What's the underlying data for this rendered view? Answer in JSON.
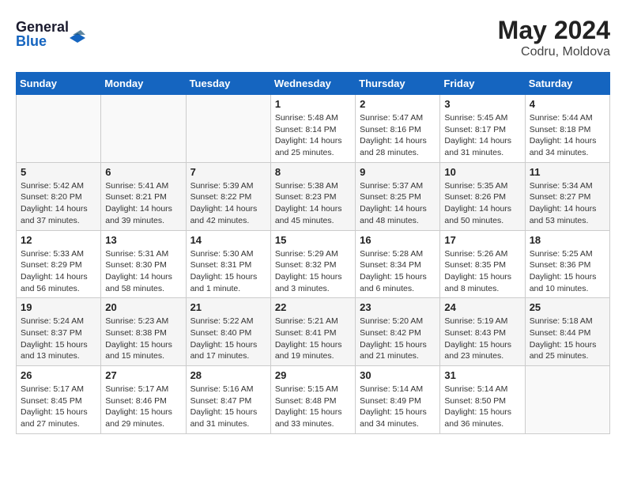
{
  "header": {
    "logo_line1": "General",
    "logo_line2": "Blue",
    "month_year": "May 2024",
    "location": "Codru, Moldova"
  },
  "weekdays": [
    "Sunday",
    "Monday",
    "Tuesday",
    "Wednesday",
    "Thursday",
    "Friday",
    "Saturday"
  ],
  "weeks": [
    [
      {
        "day": "",
        "info": ""
      },
      {
        "day": "",
        "info": ""
      },
      {
        "day": "",
        "info": ""
      },
      {
        "day": "1",
        "info": "Sunrise: 5:48 AM\nSunset: 8:14 PM\nDaylight: 14 hours\nand 25 minutes."
      },
      {
        "day": "2",
        "info": "Sunrise: 5:47 AM\nSunset: 8:16 PM\nDaylight: 14 hours\nand 28 minutes."
      },
      {
        "day": "3",
        "info": "Sunrise: 5:45 AM\nSunset: 8:17 PM\nDaylight: 14 hours\nand 31 minutes."
      },
      {
        "day": "4",
        "info": "Sunrise: 5:44 AM\nSunset: 8:18 PM\nDaylight: 14 hours\nand 34 minutes."
      }
    ],
    [
      {
        "day": "5",
        "info": "Sunrise: 5:42 AM\nSunset: 8:20 PM\nDaylight: 14 hours\nand 37 minutes."
      },
      {
        "day": "6",
        "info": "Sunrise: 5:41 AM\nSunset: 8:21 PM\nDaylight: 14 hours\nand 39 minutes."
      },
      {
        "day": "7",
        "info": "Sunrise: 5:39 AM\nSunset: 8:22 PM\nDaylight: 14 hours\nand 42 minutes."
      },
      {
        "day": "8",
        "info": "Sunrise: 5:38 AM\nSunset: 8:23 PM\nDaylight: 14 hours\nand 45 minutes."
      },
      {
        "day": "9",
        "info": "Sunrise: 5:37 AM\nSunset: 8:25 PM\nDaylight: 14 hours\nand 48 minutes."
      },
      {
        "day": "10",
        "info": "Sunrise: 5:35 AM\nSunset: 8:26 PM\nDaylight: 14 hours\nand 50 minutes."
      },
      {
        "day": "11",
        "info": "Sunrise: 5:34 AM\nSunset: 8:27 PM\nDaylight: 14 hours\nand 53 minutes."
      }
    ],
    [
      {
        "day": "12",
        "info": "Sunrise: 5:33 AM\nSunset: 8:29 PM\nDaylight: 14 hours\nand 56 minutes."
      },
      {
        "day": "13",
        "info": "Sunrise: 5:31 AM\nSunset: 8:30 PM\nDaylight: 14 hours\nand 58 minutes."
      },
      {
        "day": "14",
        "info": "Sunrise: 5:30 AM\nSunset: 8:31 PM\nDaylight: 15 hours\nand 1 minute."
      },
      {
        "day": "15",
        "info": "Sunrise: 5:29 AM\nSunset: 8:32 PM\nDaylight: 15 hours\nand 3 minutes."
      },
      {
        "day": "16",
        "info": "Sunrise: 5:28 AM\nSunset: 8:34 PM\nDaylight: 15 hours\nand 6 minutes."
      },
      {
        "day": "17",
        "info": "Sunrise: 5:26 AM\nSunset: 8:35 PM\nDaylight: 15 hours\nand 8 minutes."
      },
      {
        "day": "18",
        "info": "Sunrise: 5:25 AM\nSunset: 8:36 PM\nDaylight: 15 hours\nand 10 minutes."
      }
    ],
    [
      {
        "day": "19",
        "info": "Sunrise: 5:24 AM\nSunset: 8:37 PM\nDaylight: 15 hours\nand 13 minutes."
      },
      {
        "day": "20",
        "info": "Sunrise: 5:23 AM\nSunset: 8:38 PM\nDaylight: 15 hours\nand 15 minutes."
      },
      {
        "day": "21",
        "info": "Sunrise: 5:22 AM\nSunset: 8:40 PM\nDaylight: 15 hours\nand 17 minutes."
      },
      {
        "day": "22",
        "info": "Sunrise: 5:21 AM\nSunset: 8:41 PM\nDaylight: 15 hours\nand 19 minutes."
      },
      {
        "day": "23",
        "info": "Sunrise: 5:20 AM\nSunset: 8:42 PM\nDaylight: 15 hours\nand 21 minutes."
      },
      {
        "day": "24",
        "info": "Sunrise: 5:19 AM\nSunset: 8:43 PM\nDaylight: 15 hours\nand 23 minutes."
      },
      {
        "day": "25",
        "info": "Sunrise: 5:18 AM\nSunset: 8:44 PM\nDaylight: 15 hours\nand 25 minutes."
      }
    ],
    [
      {
        "day": "26",
        "info": "Sunrise: 5:17 AM\nSunset: 8:45 PM\nDaylight: 15 hours\nand 27 minutes."
      },
      {
        "day": "27",
        "info": "Sunrise: 5:17 AM\nSunset: 8:46 PM\nDaylight: 15 hours\nand 29 minutes."
      },
      {
        "day": "28",
        "info": "Sunrise: 5:16 AM\nSunset: 8:47 PM\nDaylight: 15 hours\nand 31 minutes."
      },
      {
        "day": "29",
        "info": "Sunrise: 5:15 AM\nSunset: 8:48 PM\nDaylight: 15 hours\nand 33 minutes."
      },
      {
        "day": "30",
        "info": "Sunrise: 5:14 AM\nSunset: 8:49 PM\nDaylight: 15 hours\nand 34 minutes."
      },
      {
        "day": "31",
        "info": "Sunrise: 5:14 AM\nSunset: 8:50 PM\nDaylight: 15 hours\nand 36 minutes."
      },
      {
        "day": "",
        "info": ""
      }
    ]
  ]
}
